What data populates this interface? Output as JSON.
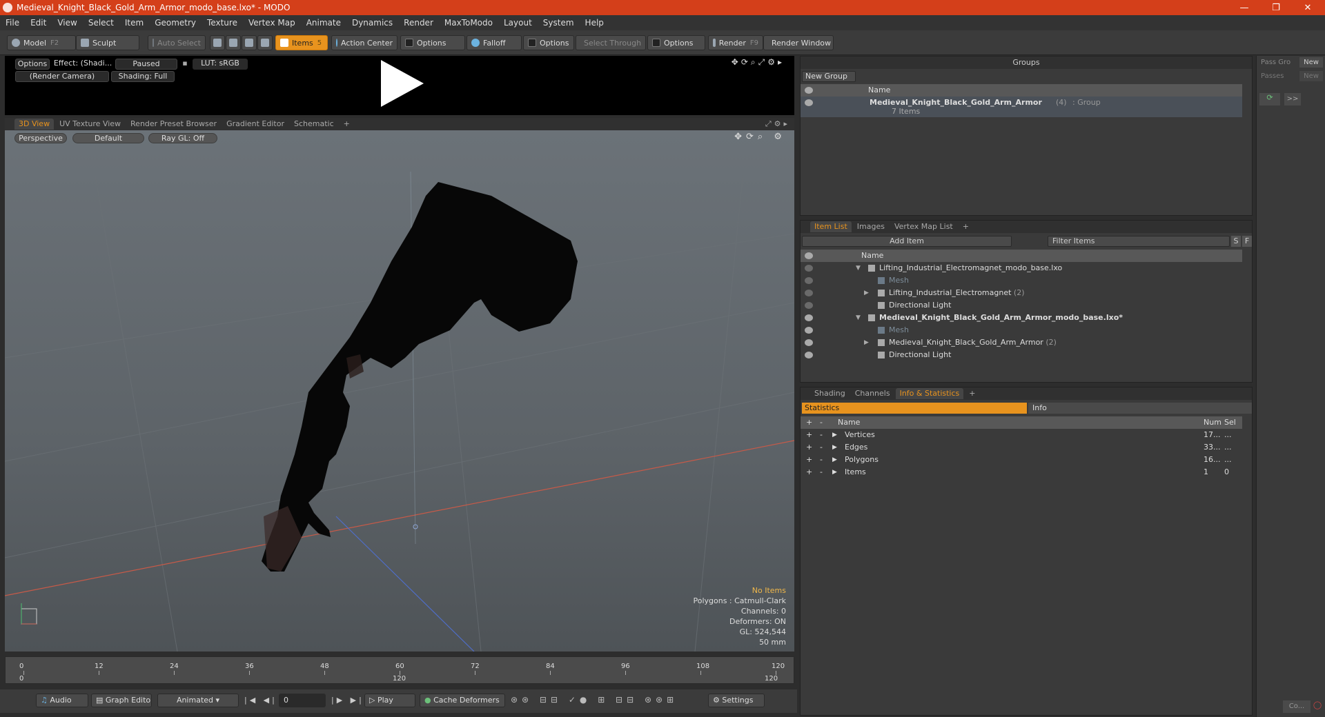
{
  "window": {
    "title": "Medieval_Knight_Black_Gold_Arm_Armor_modo_base.lxo* - MODO",
    "controls": [
      "—",
      "❐",
      "✕"
    ]
  },
  "menu": [
    "File",
    "Edit",
    "View",
    "Select",
    "Item",
    "Geometry",
    "Texture",
    "Vertex Map",
    "Animate",
    "Dynamics",
    "Render",
    "MaxToModo",
    "Layout",
    "System",
    "Help"
  ],
  "toolbar": {
    "model": "Model",
    "model_key": "F2",
    "sculpt": "Sculpt",
    "auto_select": "Auto Select",
    "items": "Items",
    "items_key": "5",
    "action_center": "Action Center",
    "options1": "Options",
    "falloff": "Falloff",
    "options2": "Options",
    "select_through": "Select Through",
    "options3": "Options",
    "render": "Render",
    "render_key": "F9",
    "render_window": "Render Window"
  },
  "preview": {
    "options": "Options",
    "effect": "Effect: (Shadi...",
    "paused": "Paused",
    "lut": "LUT: sRGB",
    "camera": "(Render Camera)",
    "shading": "Shading: Full"
  },
  "viewport_tabs": [
    "3D View",
    "UV Texture View",
    "Render Preset Browser",
    "Gradient Editor",
    "Schematic",
    "+"
  ],
  "viewport": {
    "perspective": "Perspective",
    "default": "Default",
    "raygl": "Ray GL: Off",
    "info": {
      "no_items": "No Items",
      "polygons": "Polygons : Catmull-Clark",
      "channels": "Channels: 0",
      "deformers": "Deformers: ON",
      "gl": "GL: 524,544",
      "lens": "50 mm"
    }
  },
  "timeline": {
    "ticks": [
      "0",
      "12",
      "24",
      "36",
      "48",
      "60",
      "72",
      "84",
      "96",
      "108",
      "120"
    ],
    "start": "0",
    "mid": "120",
    "end": "120"
  },
  "bottom": {
    "audio": "Audio",
    "graph_editor": "Graph Editor",
    "animated": "Animated",
    "frame": "0",
    "play": "Play",
    "cache": "Cache Deformers",
    "settings": "Settings"
  },
  "groups": {
    "title": "Groups",
    "new_group": "New Group",
    "name_col": "Name",
    "row_name": "Medieval_Knight_Black_Gold_Arm_Armor",
    "row_count": "(4)",
    "row_type": ": Group",
    "row_sub": "7 Items"
  },
  "item_list": {
    "tabs": [
      "Item List",
      "Images",
      "Vertex Map List",
      "+"
    ],
    "add_item": "Add Item",
    "filter": "Filter Items",
    "s": "S",
    "f": "F",
    "name_col": "Name",
    "rows": [
      {
        "label": "Lifting_Industrial_Electromagnet_modo_base.lxo",
        "bold": false,
        "count": ""
      },
      {
        "label": "Mesh",
        "bold": false,
        "count": ""
      },
      {
        "label": "Lifting_Industrial_Electromagnet",
        "bold": false,
        "count": "(2)"
      },
      {
        "label": "Directional Light",
        "bold": false,
        "count": ""
      },
      {
        "label": "Medieval_Knight_Black_Gold_Arm_Armor_modo_base.lxo*",
        "bold": true,
        "count": ""
      },
      {
        "label": "Mesh",
        "bold": false,
        "count": ""
      },
      {
        "label": "Medieval_Knight_Black_Gold_Arm_Armor",
        "bold": false,
        "count": "(2)"
      },
      {
        "label": "Directional Light",
        "bold": false,
        "count": ""
      }
    ]
  },
  "stats": {
    "tabs": [
      "Shading",
      "Channels",
      "Info & Statistics",
      "+"
    ],
    "statistics": "Statistics",
    "info": "Info",
    "name_col": "Name",
    "num_col": "Num",
    "sel_col": "Sel",
    "rows": [
      {
        "name": "Vertices",
        "num": "17...",
        "sel": "..."
      },
      {
        "name": "Edges",
        "num": "33...",
        "sel": "..."
      },
      {
        "name": "Polygons",
        "num": "16...",
        "sel": "..."
      },
      {
        "name": "Items",
        "num": "1",
        "sel": "0"
      }
    ]
  },
  "pass": {
    "pass_group": "Pass Gro",
    "new1": "New",
    "passes": "Passes",
    "new2": "New",
    "arrow": ">>",
    "co": "Co..."
  }
}
